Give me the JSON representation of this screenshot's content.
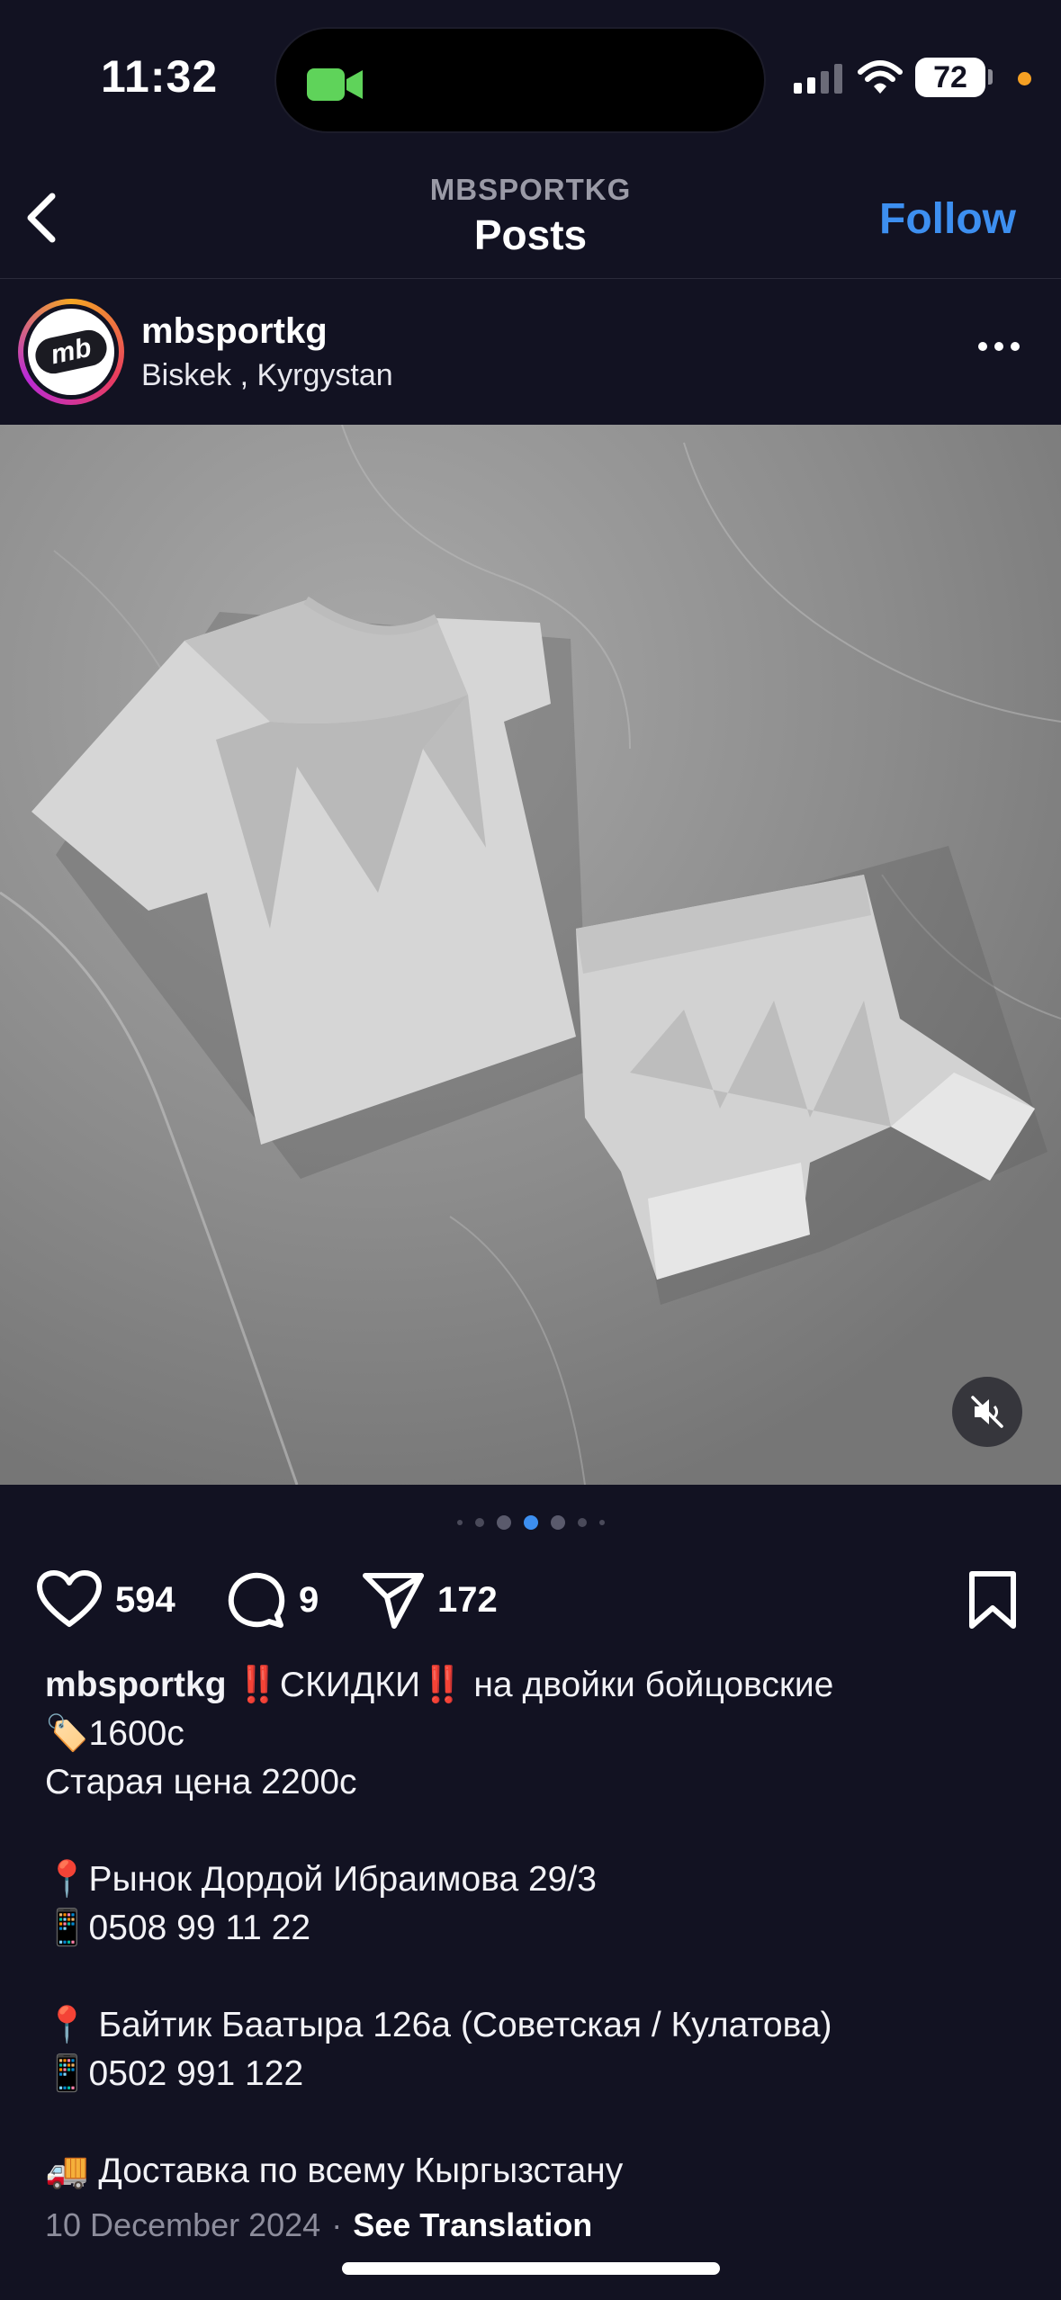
{
  "status_bar": {
    "time": "11:32",
    "battery": "72"
  },
  "nav": {
    "subtitle": "MBSPORTKG",
    "title": "Posts",
    "follow_label": "Follow"
  },
  "post": {
    "username": "mbsportkg",
    "location": "Biskek , Kyrgystan",
    "avatar_text": "mb",
    "carousel": {
      "total": 7,
      "active_index": 3
    },
    "likes": "594",
    "comments": "9",
    "shares": "172",
    "caption": {
      "username": "mbsportkg",
      "line1": "‼️СКИДКИ‼️ на двойки бойцовские",
      "line2": "🏷️1600с",
      "line3": "Старая цена 2200с",
      "line4": "📍Рынок Дордой Ибраимова 29/3",
      "line5": "📱0508 99 11 22",
      "line6": "📍 Байтик Баатыра 126а (Советская / Кулатова)",
      "line7": "📱0502 991 122",
      "line8": "🚚 Доставка по всему Кыргызстану"
    },
    "date": "10 December 2024",
    "separator": "·",
    "see_translation": "See Translation"
  },
  "icons": {
    "back": "chevron-left-icon",
    "more": "ellipsis-icon",
    "like": "heart-icon",
    "comment": "comment-bubble-icon",
    "share": "paper-plane-icon",
    "save": "bookmark-icon",
    "mute": "speaker-muted-icon"
  },
  "colors": {
    "background": "#121222",
    "accent": "#3d8ff0",
    "active_dot": "#3d8ff0"
  }
}
